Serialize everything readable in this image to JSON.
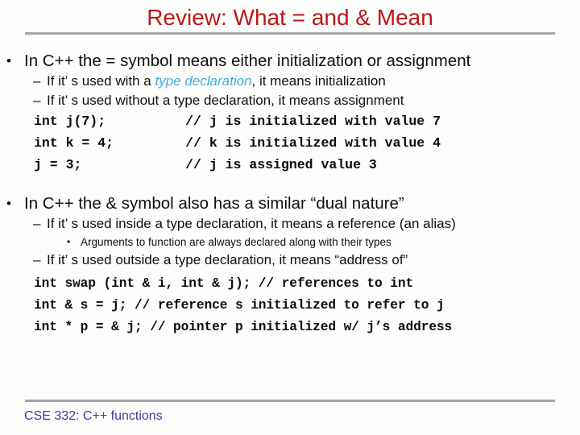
{
  "slide": {
    "title": "Review: What = and & Mean",
    "title_color": "#bb1717",
    "rule_color": "#a5a5a8",
    "background_color": "#fdfdfb",
    "emphasis_color": "#3fadda",
    "footer_color": "#3b3b9e"
  },
  "bullets": {
    "b1_marker": "•",
    "b1_text": "In C++ the = symbol means either initialization or assignment",
    "b1s1_marker": "–",
    "b1s1_prefix": "If it’ s used with a ",
    "b1s1_emph": "type declaration",
    "b1s1_suffix": ", it means initialization",
    "b1s2_marker": "–",
    "b1s2_text": "If it’ s used without a type declaration, it means assignment",
    "b2_marker": "•",
    "b2_text": "In C++ the &  symbol also has a similar “dual nature”",
    "b2s1_marker": "–",
    "b2s1_text": "If it’ s used inside a type declaration, it means a reference (an alias)",
    "b2s1a_marker": "•",
    "b2s1a_text": "Arguments to function are always declared along with their types",
    "b2s2_marker": "–",
    "b2s2_text": "If it’ s used outside a type declaration, it means “address of”"
  },
  "code": {
    "line1": "int j(7);          // j is initialized with value 7",
    "line2": "int k = 4;         // k is initialized with value 4",
    "line3": "j = 3;             // j is assigned value 3",
    "line4": "int swap (int & i, int & j); // references to int",
    "line5": "int & s = j; // reference s initialized to refer to j",
    "line6": "int * p = & j; // pointer p initialized w/ j’s address"
  },
  "footer": {
    "text": "CSE 332: C++ functions"
  }
}
